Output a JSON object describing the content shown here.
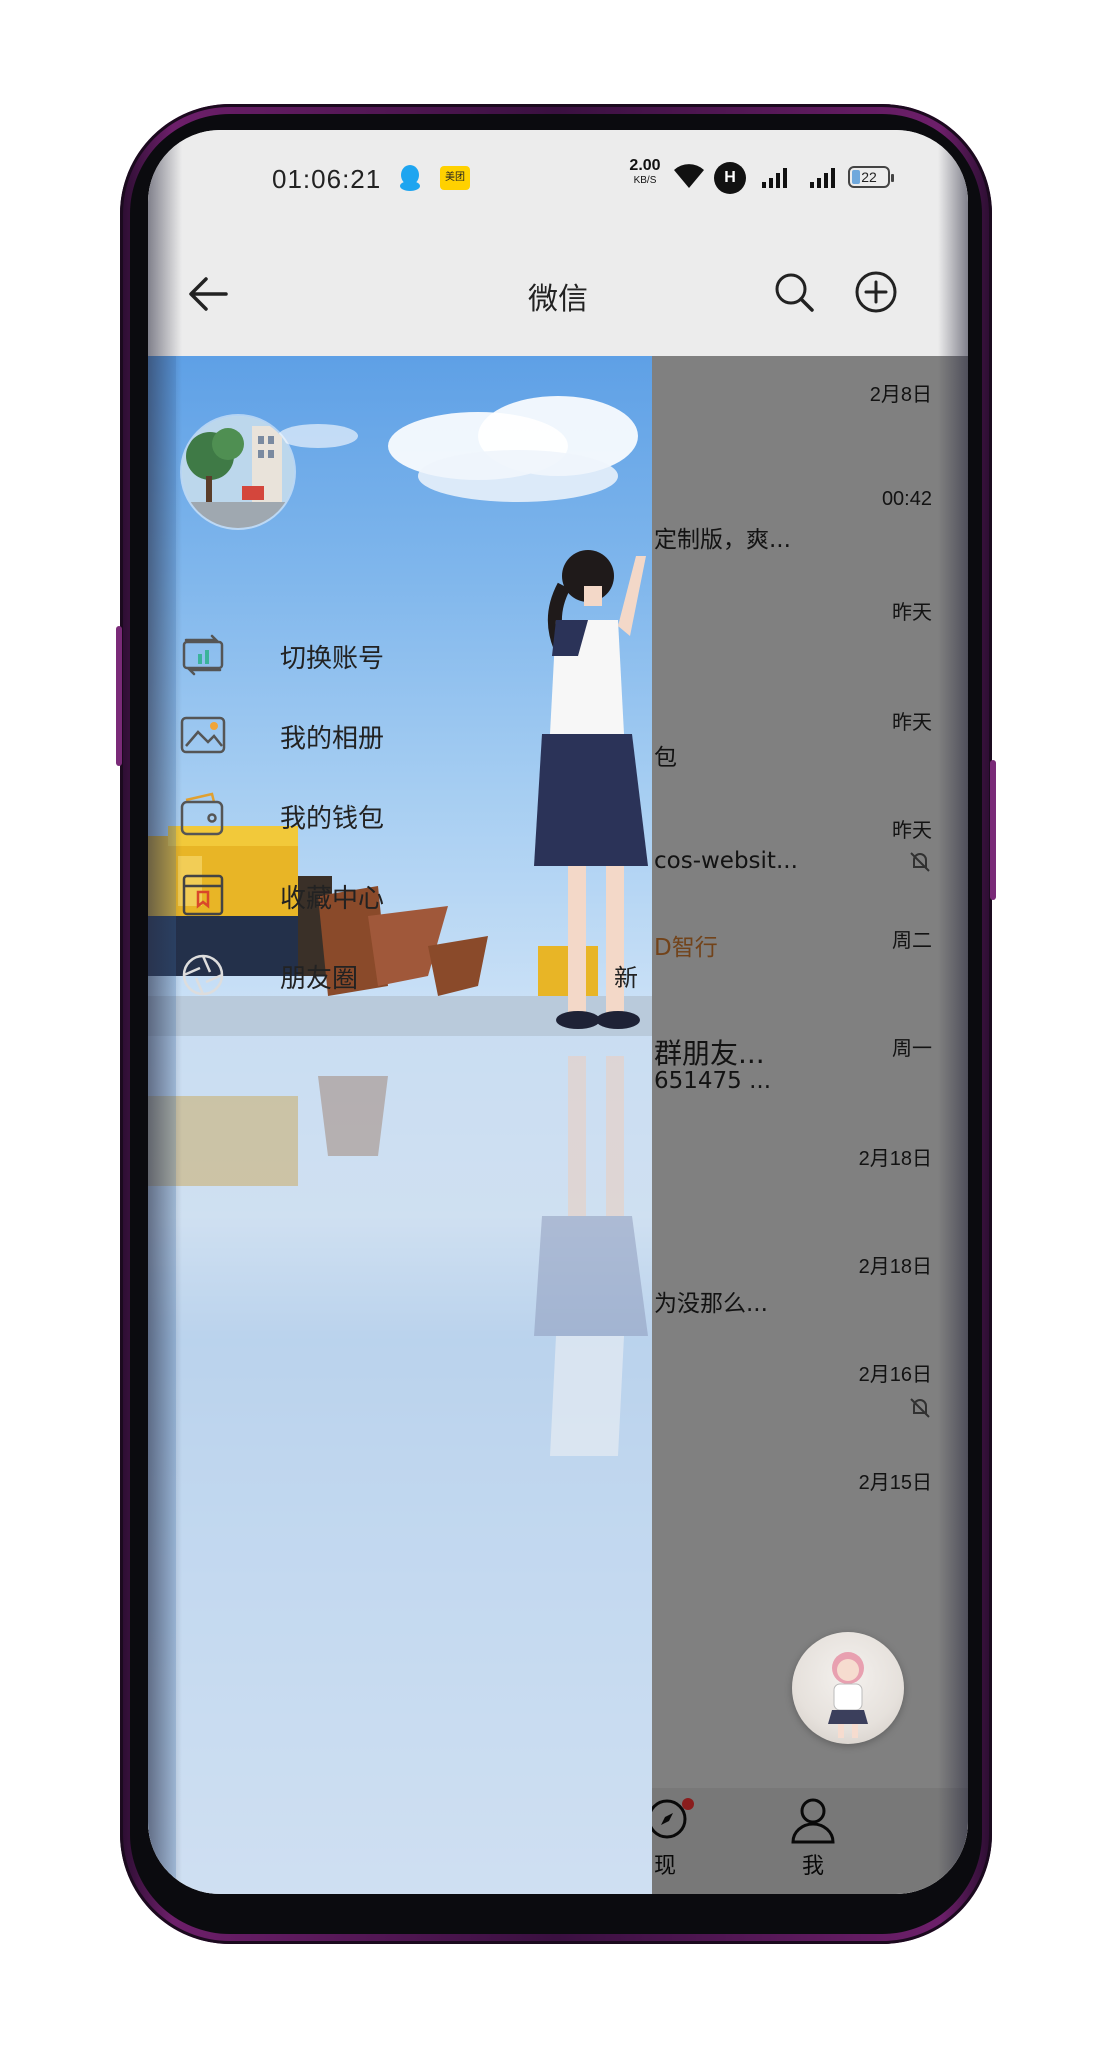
{
  "status_bar": {
    "time": "01:06:21",
    "meituan": "美团",
    "net_speed_value": "2.00",
    "net_speed_unit": "KB/S",
    "hd_label": "H",
    "battery": "22"
  },
  "app_bar": {
    "title": "微信"
  },
  "chat_list": {
    "times": [
      "2月8日",
      "00:42",
      "昨天",
      "昨天",
      "昨天",
      "周二",
      "周一",
      "2月18日",
      "2月18日",
      "2月16日",
      "2月15日"
    ],
    "snippets": [
      "定制版，爽...",
      "包",
      "cos-websit...",
      "D智行",
      "群朋友...",
      "651475 ...",
      "为没那么..."
    ]
  },
  "bottom_nav": {
    "discover_label": "现",
    "me_label": "我"
  },
  "drawer": {
    "menu": [
      {
        "label": "切换账号",
        "icon": "switch-account-icon"
      },
      {
        "label": "我的相册",
        "icon": "photo-album-icon"
      },
      {
        "label": "我的钱包",
        "icon": "wallet-icon"
      },
      {
        "label": "收藏中心",
        "icon": "favorites-icon"
      },
      {
        "label": "朋友圈",
        "icon": "moments-icon",
        "badge": "新"
      }
    ]
  },
  "colors": {
    "accent_orange": "#c5742d",
    "badge_red": "#e33333",
    "phone_frame": "#6d1f6a"
  }
}
